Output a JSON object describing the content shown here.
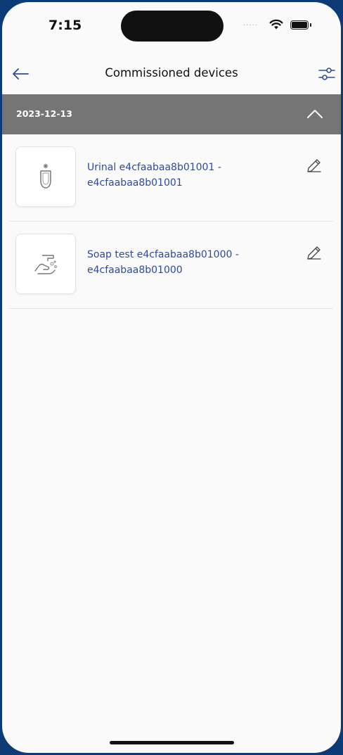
{
  "status_bar": {
    "time": "7:15",
    "signal_dots": "....."
  },
  "header": {
    "title": "Commissioned devices",
    "back_icon": "arrow-left-icon",
    "filter_icon": "sliders-icon"
  },
  "group": {
    "date": "2023-12-13",
    "toggle_icon": "chevron-up-icon"
  },
  "devices": [
    {
      "label": "Urinal e4cfaabaa8b01001 - e4cfaabaa8b01001",
      "icon": "urinal-icon",
      "edit_icon": "pencil-icon"
    },
    {
      "label": "Soap test e4cfaabaa8b01000 - e4cfaabaa8b01000",
      "icon": "soap-dispenser-icon",
      "edit_icon": "pencil-icon"
    }
  ],
  "colors": {
    "frame": "#0d3b78",
    "accent": "#2d4aa0",
    "date_band": "#757575",
    "background": "#fafafa"
  }
}
